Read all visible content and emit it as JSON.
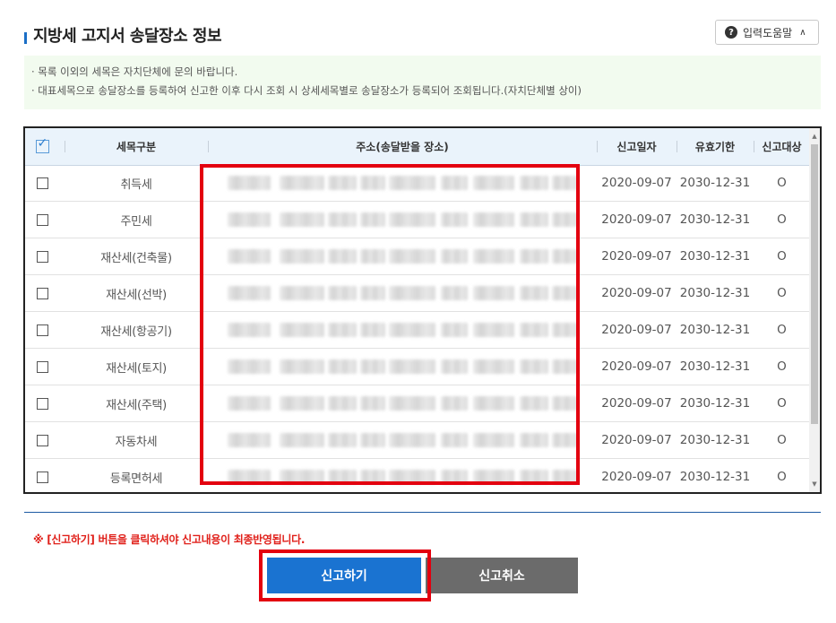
{
  "page": {
    "title": "지방세 고지서 송달장소 정보",
    "help_label": "입력도움말",
    "help_icon": "question-circle-icon",
    "collapse_icon": "chevron-up-icon"
  },
  "notice": {
    "lines": [
      "· 목록 이외의 세목은 자치단체에 문의 바랍니다.",
      "· 대표세목으로 송달장소를 등록하여 신고한 이후 다시 조회 시 상세세목별로 송달장소가 등록되어 조회됩니다.(자치단체별 상이)"
    ]
  },
  "table": {
    "headers": {
      "tax_type": "세목구분",
      "address": "주소(송달받을 장소)",
      "report_date": "신고일자",
      "expiry_date": "유효기한",
      "report_target": "신고대상"
    },
    "rows": [
      {
        "tax_type": "취득세",
        "report_date": "2020-09-07",
        "expiry_date": "2030-12-31",
        "target": "O"
      },
      {
        "tax_type": "주민세",
        "report_date": "2020-09-07",
        "expiry_date": "2030-12-31",
        "target": "O"
      },
      {
        "tax_type": "재산세(건축물)",
        "report_date": "2020-09-07",
        "expiry_date": "2030-12-31",
        "target": "O"
      },
      {
        "tax_type": "재산세(선박)",
        "report_date": "2020-09-07",
        "expiry_date": "2030-12-31",
        "target": "O"
      },
      {
        "tax_type": "재산세(항공기)",
        "report_date": "2020-09-07",
        "expiry_date": "2030-12-31",
        "target": "O"
      },
      {
        "tax_type": "재산세(토지)",
        "report_date": "2020-09-07",
        "expiry_date": "2030-12-31",
        "target": "O"
      },
      {
        "tax_type": "재산세(주택)",
        "report_date": "2020-09-07",
        "expiry_date": "2030-12-31",
        "target": "O"
      },
      {
        "tax_type": "자동차세",
        "report_date": "2020-09-07",
        "expiry_date": "2030-12-31",
        "target": "O"
      },
      {
        "tax_type": "등록면허세",
        "report_date": "2020-09-07",
        "expiry_date": "2030-12-31",
        "target": "O"
      }
    ]
  },
  "footer": {
    "warning": "※ [신고하기] 버튼을 클릭하셔야 신고내용이 최종반영됩니다.",
    "submit_label": "신고하기",
    "cancel_label": "신고취소"
  },
  "colors": {
    "accent": "#1a73d1",
    "highlight": "#e3000f",
    "warning": "#e0201a",
    "cancel": "#6b6b6b"
  }
}
